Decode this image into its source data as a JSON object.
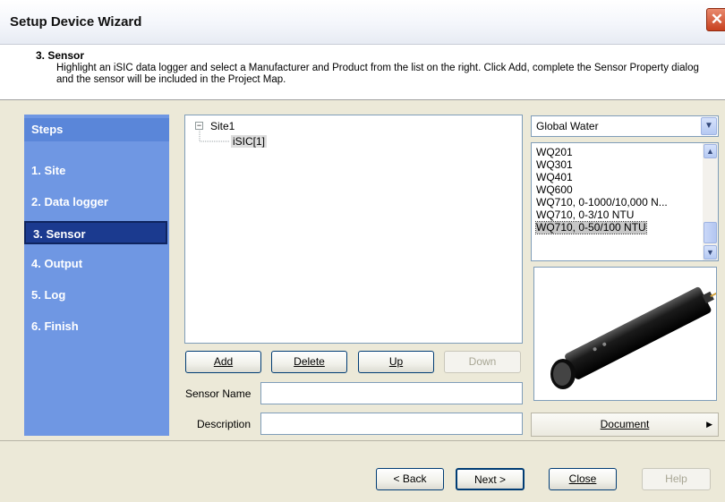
{
  "window": {
    "title": "Setup Device Wizard",
    "close_glyph": "✕"
  },
  "header": {
    "step_title": "3. Sensor",
    "description": "Highlight an iSIC data logger and select a Manufacturer and Product from the list on the right. Click Add, complete the Sensor Property dialog and the sensor will be included in the Project Map."
  },
  "steps": {
    "heading": "Steps",
    "items": [
      "1. Site",
      "2. Data logger",
      "3. Sensor",
      "4. Output",
      "5. Log",
      "6. Finish"
    ],
    "selected": "3. Sensor"
  },
  "tree": {
    "expander": "−",
    "root": "Site1",
    "child": "iSIC[1]"
  },
  "tree_buttons": {
    "add": "Add",
    "delete": "Delete",
    "up": "Up",
    "down": "Down"
  },
  "form": {
    "sensor_name_label": "Sensor Name",
    "sensor_name_value": "",
    "description_label": "Description",
    "description_value": ""
  },
  "manufacturer": {
    "selected": "Global Water"
  },
  "products": {
    "items": [
      "WQ201",
      "WQ301",
      "WQ401",
      "WQ600",
      "WQ710, 0-1000/10,000 N...",
      "WQ710, 0-3/10 NTU",
      "WQ710, 0-50/100 NTU"
    ],
    "selected": "WQ710, 0-50/100 NTU"
  },
  "document_button": {
    "label": "Document",
    "arrow": "▶"
  },
  "footer": {
    "back": "< Back",
    "next": "Next >",
    "close": "Close",
    "help": "Help"
  },
  "colors": {
    "steps_panel": "#6f97e3",
    "steps_selected": "#1b3a8f",
    "window_bg": "#ece9d8"
  }
}
